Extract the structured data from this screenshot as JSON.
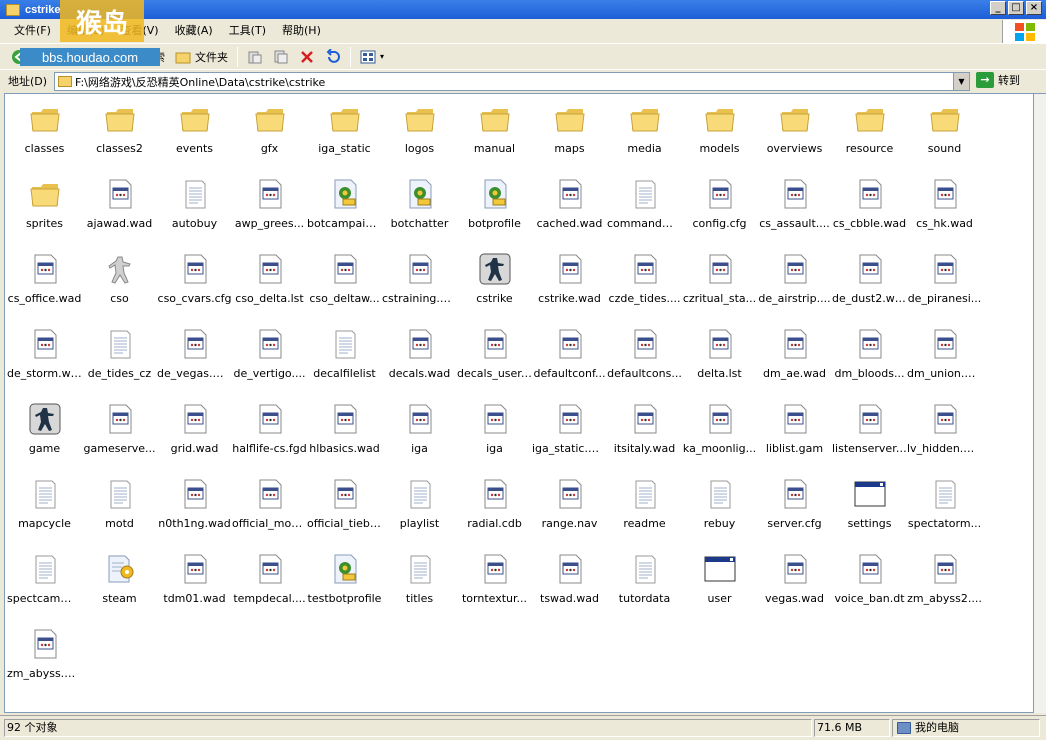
{
  "window": {
    "title": "cstrike"
  },
  "menu": [
    "文件(F)",
    "编辑(E)",
    "查看(V)",
    "收藏(A)",
    "工具(T)",
    "帮助(H)"
  ],
  "watermark": {
    "text": "bbs.houdao.com",
    "brand": "猴岛"
  },
  "toolbar": {
    "back": "后退",
    "search": "搜索",
    "folders": "文件夹"
  },
  "address": {
    "label": "地址(D)",
    "path": "F:\\网络游戏\\反恐精英Online\\Data\\cstrike\\cstrike",
    "go": "转到"
  },
  "files": [
    {
      "name": "classes",
      "type": "folder"
    },
    {
      "name": "classes2",
      "type": "folder"
    },
    {
      "name": "events",
      "type": "folder"
    },
    {
      "name": "gfx",
      "type": "folder"
    },
    {
      "name": "iga_static",
      "type": "folder"
    },
    {
      "name": "logos",
      "type": "folder"
    },
    {
      "name": "manual",
      "type": "folder"
    },
    {
      "name": "maps",
      "type": "folder"
    },
    {
      "name": "media",
      "type": "folder"
    },
    {
      "name": "models",
      "type": "folder"
    },
    {
      "name": "overviews",
      "type": "folder"
    },
    {
      "name": "resource",
      "type": "folder"
    },
    {
      "name": "sound",
      "type": "folder"
    },
    {
      "name": "sprites",
      "type": "folder"
    },
    {
      "name": "ajawad.wad",
      "type": "wad"
    },
    {
      "name": "autobuy",
      "type": "text"
    },
    {
      "name": "awp_grees...",
      "type": "wad"
    },
    {
      "name": "botcampaig...",
      "type": "script"
    },
    {
      "name": "botchatter",
      "type": "script"
    },
    {
      "name": "botprofile",
      "type": "script"
    },
    {
      "name": "cached.wad",
      "type": "wad"
    },
    {
      "name": "commandmenu",
      "type": "text"
    },
    {
      "name": "config.cfg",
      "type": "wad"
    },
    {
      "name": "cs_assault....",
      "type": "wad"
    },
    {
      "name": "cs_cbble.wad",
      "type": "wad"
    },
    {
      "name": "cs_hk.wad",
      "type": "wad"
    },
    {
      "name": "cs_office.wad",
      "type": "wad"
    },
    {
      "name": "cso",
      "type": "cso"
    },
    {
      "name": "cso_cvars.cfg",
      "type": "wad"
    },
    {
      "name": "cso_delta.lst",
      "type": "wad"
    },
    {
      "name": "cso_deltaw...",
      "type": "wad"
    },
    {
      "name": "cstraining.wad",
      "type": "wad"
    },
    {
      "name": "cstrike",
      "type": "exe"
    },
    {
      "name": "cstrike.wad",
      "type": "wad"
    },
    {
      "name": "czde_tides....",
      "type": "wad"
    },
    {
      "name": "czritual_sta...",
      "type": "wad"
    },
    {
      "name": "de_airstrip....",
      "type": "wad"
    },
    {
      "name": "de_dust2.wad",
      "type": "wad"
    },
    {
      "name": "de_piranesi...",
      "type": "wad"
    },
    {
      "name": "de_storm.wad",
      "type": "wad"
    },
    {
      "name": "de_tides_cz",
      "type": "text"
    },
    {
      "name": "de_vegas.wad",
      "type": "wad"
    },
    {
      "name": "de_vertigo....",
      "type": "wad"
    },
    {
      "name": "decalfilelist",
      "type": "text"
    },
    {
      "name": "decals.wad",
      "type": "wad"
    },
    {
      "name": "decals_user....",
      "type": "wad"
    },
    {
      "name": "defaultconf...",
      "type": "wad"
    },
    {
      "name": "defaultcons...",
      "type": "wad"
    },
    {
      "name": "delta.lst",
      "type": "wad"
    },
    {
      "name": "dm_ae.wad",
      "type": "wad"
    },
    {
      "name": "dm_bloods...",
      "type": "wad"
    },
    {
      "name": "dm_union.wad",
      "type": "wad"
    },
    {
      "name": "game",
      "type": "exe"
    },
    {
      "name": "gameserve...",
      "type": "wad"
    },
    {
      "name": "grid.wad",
      "type": "wad"
    },
    {
      "name": "halflife-cs.fgd",
      "type": "wad"
    },
    {
      "name": "hlbasics.wad",
      "type": "wad"
    },
    {
      "name": "iga",
      "type": "wad"
    },
    {
      "name": "iga",
      "type": "wad"
    },
    {
      "name": "iga_static.wad",
      "type": "wad"
    },
    {
      "name": "itsitaly.wad",
      "type": "wad"
    },
    {
      "name": "ka_moonlig...",
      "type": "wad"
    },
    {
      "name": "liblist.gam",
      "type": "wad"
    },
    {
      "name": "listenserver....",
      "type": "wad"
    },
    {
      "name": "lv_hidden.wad",
      "type": "wad"
    },
    {
      "name": "mapcycle",
      "type": "text"
    },
    {
      "name": "motd",
      "type": "text"
    },
    {
      "name": "n0th1ng.wad",
      "type": "wad"
    },
    {
      "name": "official_mod....",
      "type": "wad"
    },
    {
      "name": "official_tiebr...",
      "type": "wad"
    },
    {
      "name": "playlist",
      "type": "text"
    },
    {
      "name": "radial.cdb",
      "type": "wad"
    },
    {
      "name": "range.nav",
      "type": "wad"
    },
    {
      "name": "readme",
      "type": "text"
    },
    {
      "name": "rebuy",
      "type": "text"
    },
    {
      "name": "server.cfg",
      "type": "wad"
    },
    {
      "name": "settings",
      "type": "window"
    },
    {
      "name": "spectatorm...",
      "type": "text"
    },
    {
      "name": "spectcammenu",
      "type": "text"
    },
    {
      "name": "steam",
      "type": "steam"
    },
    {
      "name": "tdm01.wad",
      "type": "wad"
    },
    {
      "name": "tempdecal....",
      "type": "wad"
    },
    {
      "name": "testbotprofile",
      "type": "script"
    },
    {
      "name": "titles",
      "type": "text"
    },
    {
      "name": "torntextur...",
      "type": "wad"
    },
    {
      "name": "tswad.wad",
      "type": "wad"
    },
    {
      "name": "tutordata",
      "type": "text"
    },
    {
      "name": "user",
      "type": "window"
    },
    {
      "name": "vegas.wad",
      "type": "wad"
    },
    {
      "name": "voice_ban.dt",
      "type": "wad"
    },
    {
      "name": "zm_abyss2....",
      "type": "wad"
    },
    {
      "name": "zm_abyss.wad",
      "type": "wad"
    }
  ],
  "status": {
    "count": "92 个对象",
    "size": "71.6 MB",
    "location": "我的电脑"
  },
  "colors": {
    "titlebar": "#1d5ed8",
    "chrome": "#ece9d8",
    "folder": "#f6d36a"
  }
}
